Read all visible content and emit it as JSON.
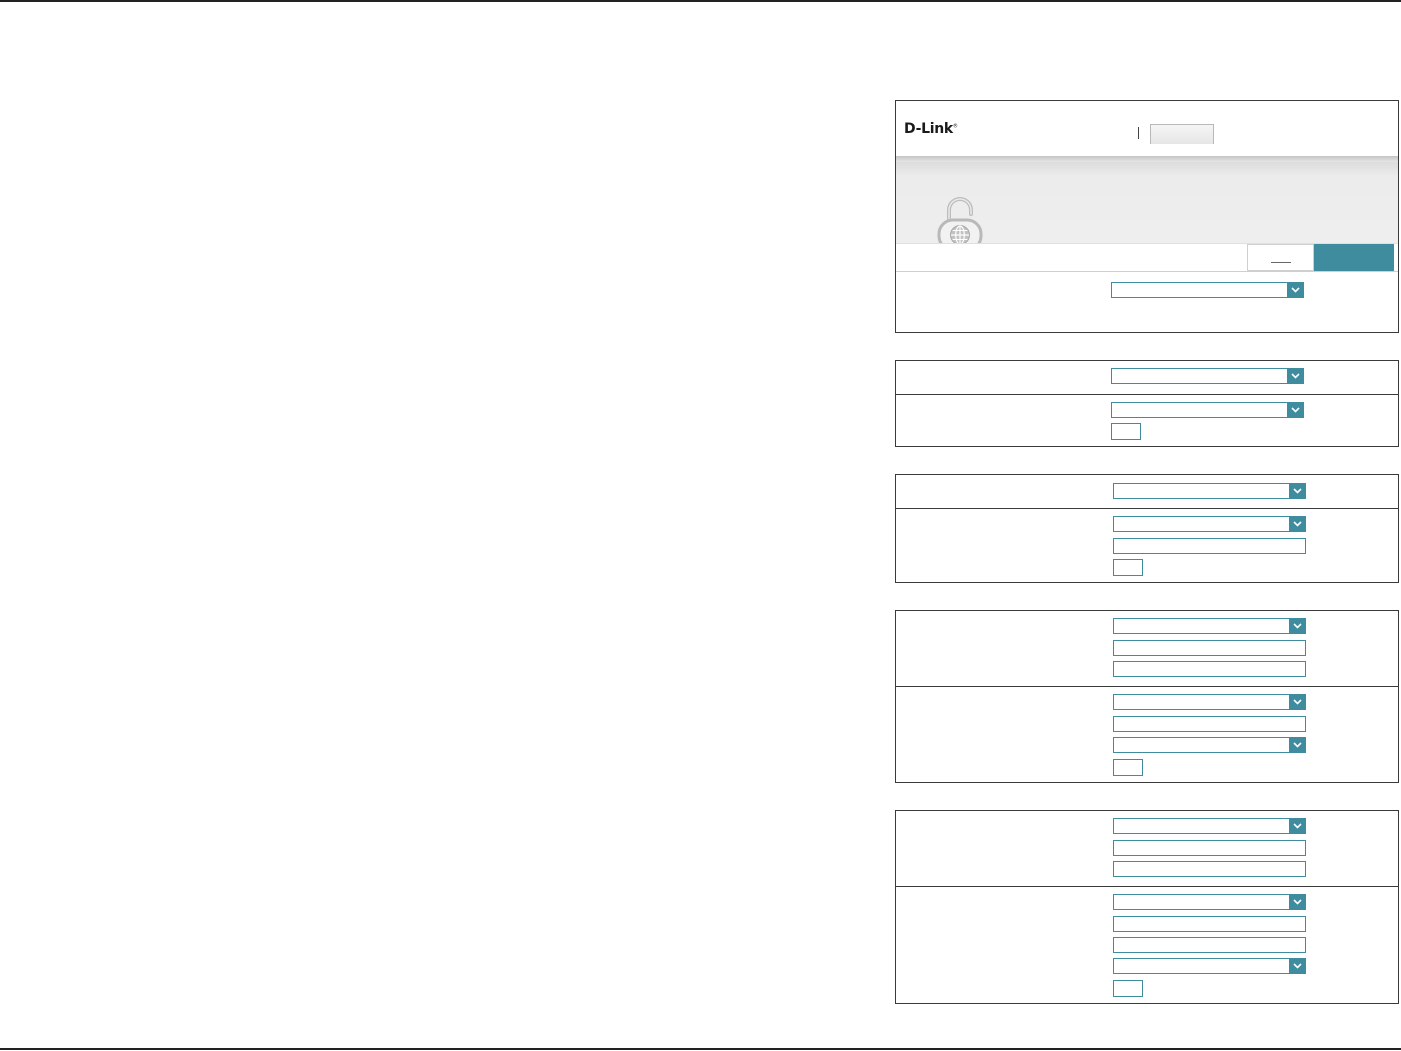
{
  "logo": {
    "text": "D-Link",
    "mark": "®"
  },
  "icons": {
    "lock": "unlocked-padlock-globe-icon",
    "dropdown": "chevron-down-icon"
  },
  "colors": {
    "accent": "#3e8c9e",
    "border": "#3a3a3a",
    "rule": "#222222"
  }
}
